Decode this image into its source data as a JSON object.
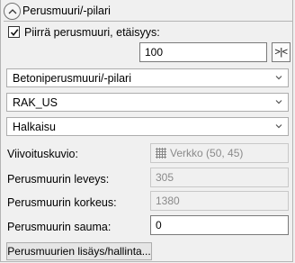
{
  "header": {
    "title": "Perusmuuri/-pilari"
  },
  "draw_option": {
    "label": "Piirrä perusmuuri, etäisyys:",
    "checked": true,
    "distance_value": "100",
    "distance_button": ">|<"
  },
  "dropdowns": {
    "type": "Betoniperusmuuri/-pilari",
    "layer": "RAK_US",
    "section": "Halkaisu"
  },
  "fields": {
    "hatch_label": "Viivoituskuvio:",
    "hatch_value": "Verkko (50, 45)",
    "width_label": "Perusmuurin leveys:",
    "width_value": "305",
    "height_label": "Perusmuurin korkeus:",
    "height_value": "1380",
    "joint_label": "Perusmuurin sauma:",
    "joint_value": "0"
  },
  "footer": {
    "manage_button": "Perusmuurien lisäys/hallinta..."
  },
  "icons": {
    "collapse": "chevron-up-icon",
    "check": "check-icon",
    "dropdown": "chevron-down-icon",
    "hatch": "grid-pattern-icon"
  }
}
